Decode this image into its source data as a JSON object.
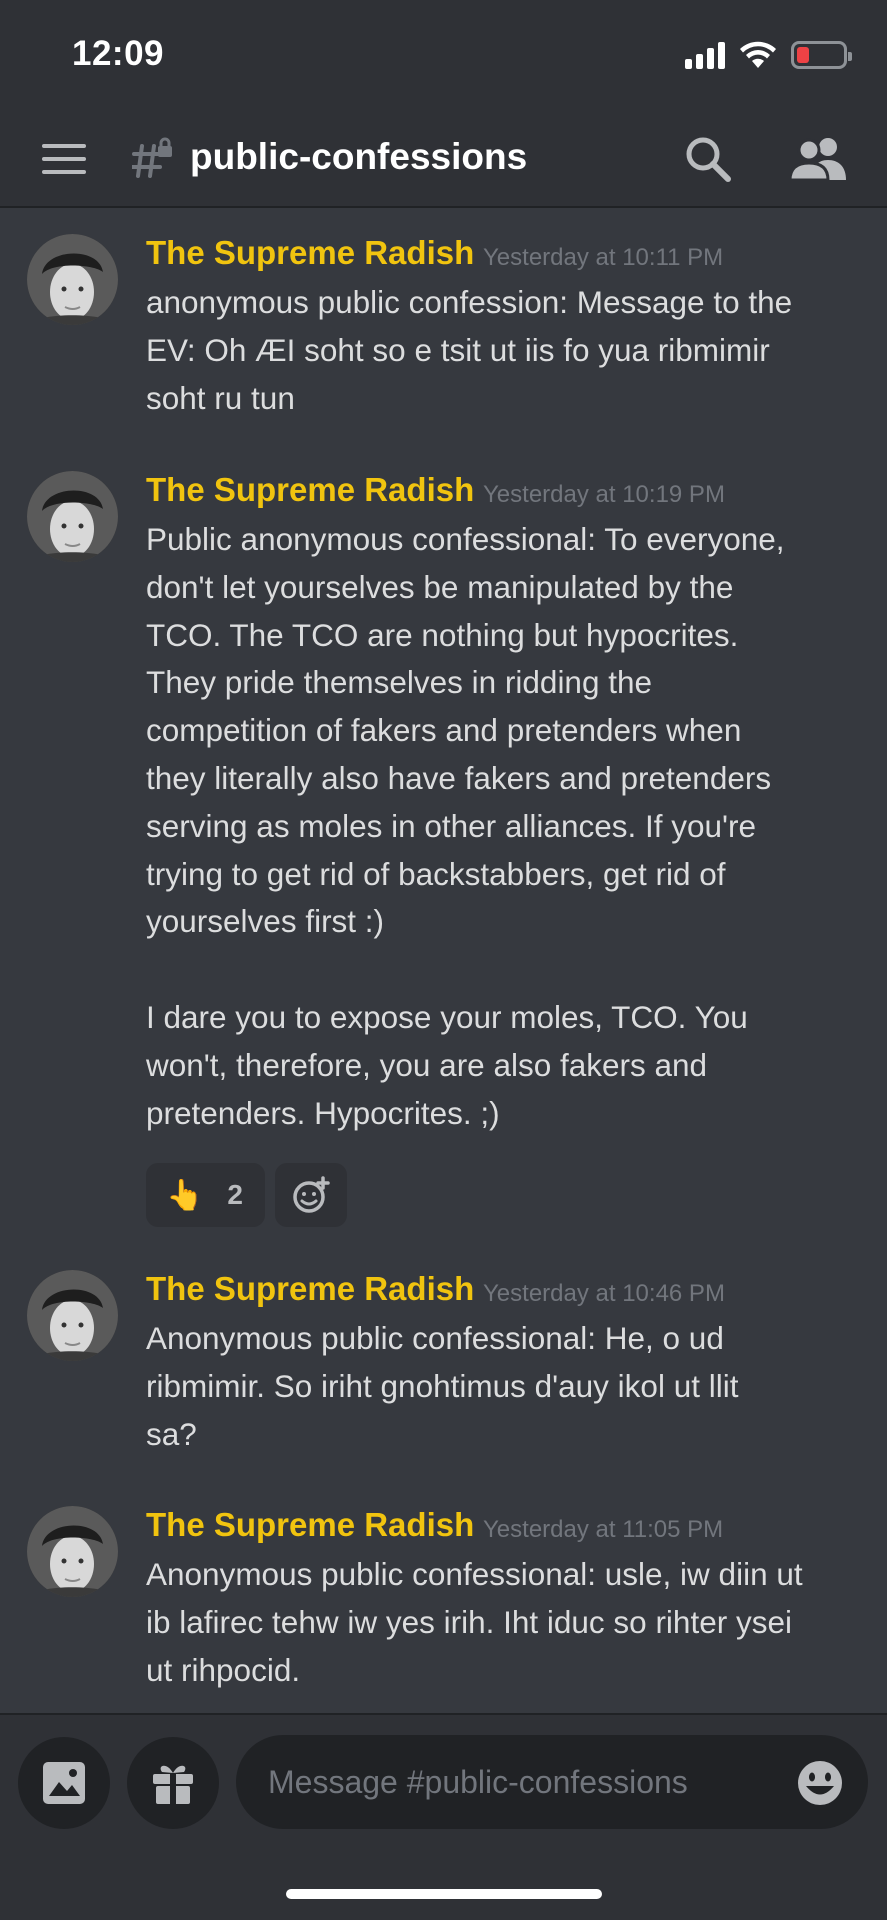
{
  "status_bar": {
    "time": "12:09",
    "icons": [
      "signal-icon",
      "wifi-icon",
      "battery-icon"
    ],
    "battery_color": "#ed4245"
  },
  "header": {
    "channel_name": "public-confessions",
    "icons": [
      "menu-icon",
      "locked-hash-icon",
      "search-icon",
      "members-icon"
    ]
  },
  "messages": [
    {
      "author": "The Supreme Radish",
      "timestamp": "Yesterday at 10:11 PM",
      "text": "anonymous public confession: Message to the\nEV: Oh ÆI soht so e tsit ut iis fo yua ribmimir\nsoht ru tun"
    },
    {
      "author": "The Supreme Radish",
      "timestamp": "Yesterday at 10:19 PM",
      "text": "Public anonymous confessional: To everyone,\ndon't let yourselves be manipulated by the\nTCO. The TCO are nothing but hypocrites.\nThey pride themselves in ridding the\ncompetition of fakers and pretenders when\nthey literally also have fakers and pretenders\nserving as moles in other alliances. If you're\ntrying to get rid of backstabbers, get rid of\nyourselves first :)\n\nI dare you to expose your moles, TCO. You\nwon't, therefore, you are also fakers and\npretenders. Hypocrites. ;)",
      "reactions": [
        {
          "emoji": "👆",
          "count": "2"
        }
      ]
    },
    {
      "author": "The Supreme Radish",
      "timestamp": "Yesterday at 10:46 PM",
      "text": "Anonymous public confessional: He, o ud\nribmimir. So iriht gnohtimus d'auy ikol ut llit\nsa?"
    },
    {
      "author": "The Supreme Radish",
      "timestamp": "Yesterday at 11:05 PM",
      "text": "Anonymous public confessional: usle, iw diin ut\nib lafirec tehw iw yes irih. Iht iduc so rihter ysei\nut rihpocid."
    }
  ],
  "composer": {
    "placeholder": "Message #public-confessions",
    "icons": [
      "image-icon",
      "gift-icon",
      "emoji-icon"
    ]
  },
  "colors": {
    "background": "#36393f",
    "header": "#2f3136",
    "username": "#f1c40f",
    "timestamp": "#72767d"
  }
}
